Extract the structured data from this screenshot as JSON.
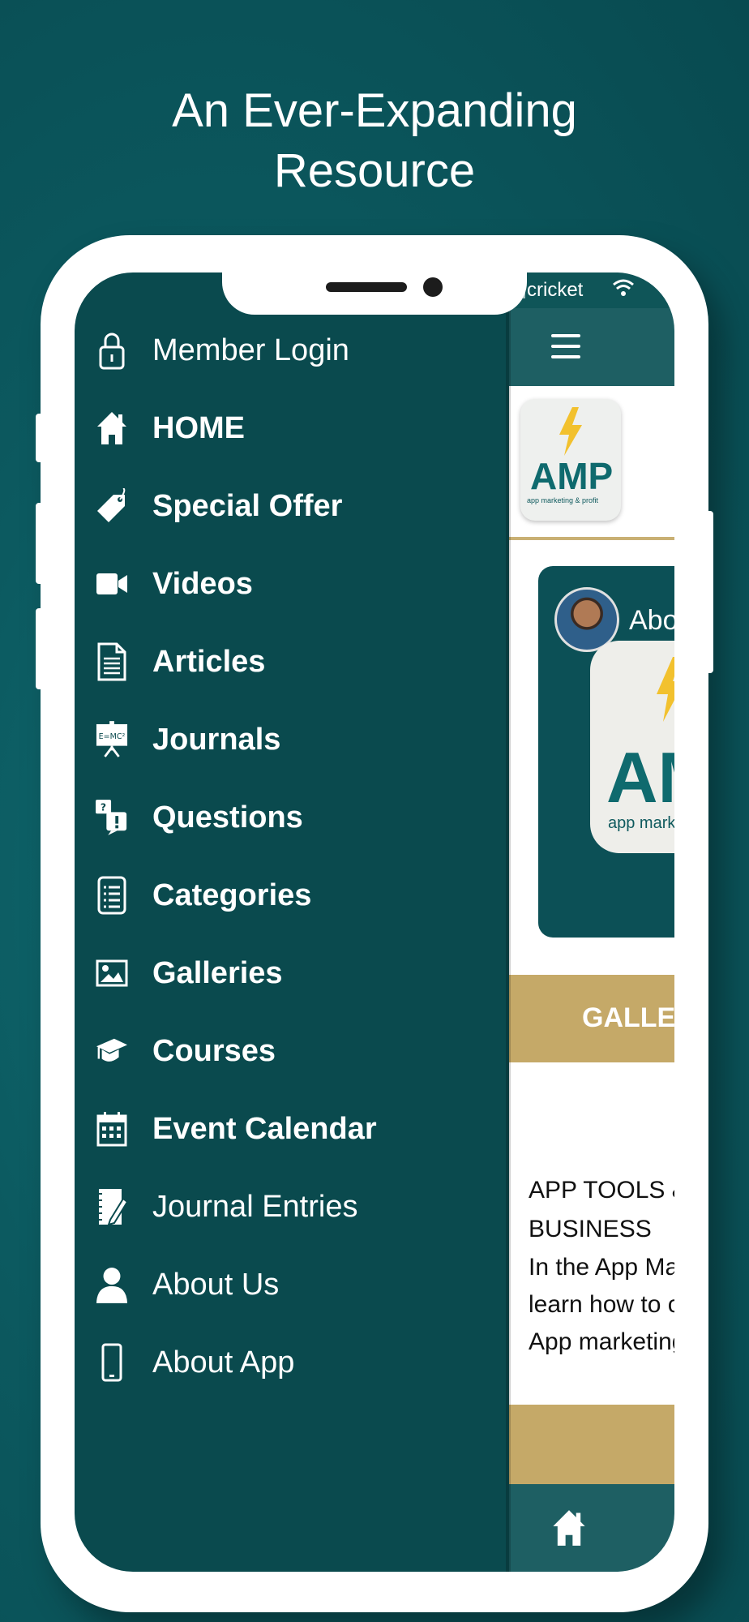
{
  "headline": {
    "line1": "An Ever-Expanding",
    "line2": "Resource"
  },
  "status_bar": {
    "carrier": "cricket"
  },
  "menu": {
    "items": [
      {
        "label": "Member Login",
        "icon": "lock-icon",
        "weight": "light"
      },
      {
        "label": "HOME",
        "icon": "home-icon",
        "weight": "bold"
      },
      {
        "label": "Special Offer",
        "icon": "tag-icon",
        "weight": "bold"
      },
      {
        "label": "Videos",
        "icon": "video-camera-icon",
        "weight": "bold"
      },
      {
        "label": "Articles",
        "icon": "document-icon",
        "weight": "bold"
      },
      {
        "label": "Journals",
        "icon": "presentation-board-icon",
        "weight": "bold"
      },
      {
        "label": "Questions",
        "icon": "question-bubbles-icon",
        "weight": "bold"
      },
      {
        "label": "Categories",
        "icon": "list-icon",
        "weight": "bold"
      },
      {
        "label": "Galleries",
        "icon": "image-icon",
        "weight": "bold"
      },
      {
        "label": "Courses",
        "icon": "graduation-cap-icon",
        "weight": "bold"
      },
      {
        "label": "Event Calendar",
        "icon": "calendar-icon",
        "weight": "bold"
      },
      {
        "label": "Journal Entries",
        "icon": "notebook-pen-icon",
        "weight": "light"
      },
      {
        "label": "About Us",
        "icon": "user-icon",
        "weight": "light"
      },
      {
        "label": "About App",
        "icon": "phone-icon",
        "weight": "light"
      }
    ]
  },
  "content": {
    "logo_text": "AMP",
    "logo_tagline": "app marketing & profit",
    "about_label": "Abo",
    "big_logo_text": "AM",
    "big_logo_tagline": "app marke",
    "gallery_label": "GALLEF",
    "description_title": "APP TOOLS &\nBUSINESS",
    "description_body": "In the App Ma\nlearn how to c\nApp marketing"
  },
  "colors": {
    "background": "#0c5a60",
    "drawer": "#0a4a4e",
    "app_bar": "#1e5f63",
    "gold": "#c5a968",
    "logo_teal": "#0f6a6e",
    "bolt_yellow": "#f2c12e"
  }
}
